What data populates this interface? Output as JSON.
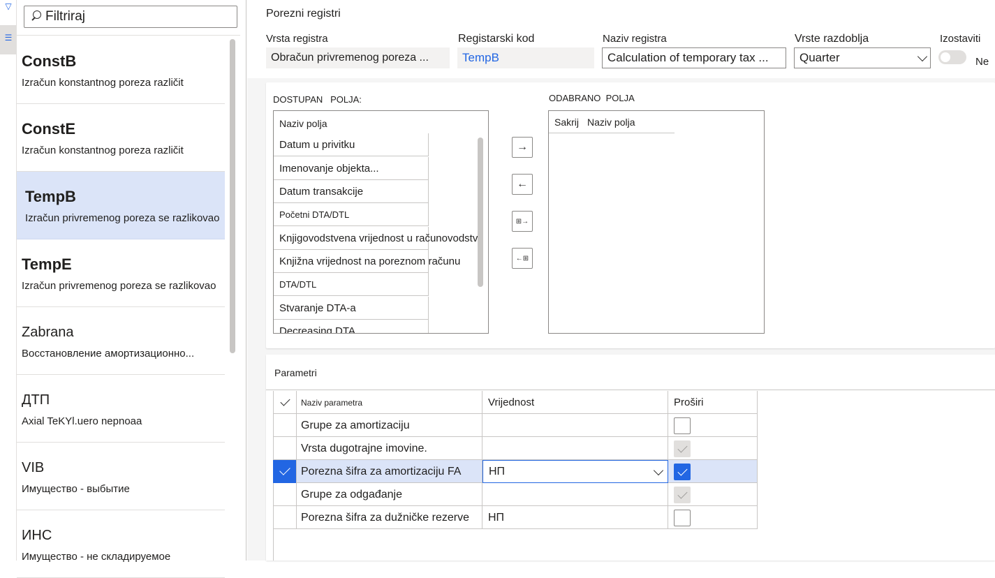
{
  "nav": {
    "icons": [
      "filter-icon",
      "list-icon"
    ]
  },
  "list": {
    "filter_placeholder": "Filtriraj",
    "items": [
      {
        "code": "ConstB",
        "desc": "Izračun konstantnog poreza različit"
      },
      {
        "code": "ConstE",
        "desc": "Izračun konstantnog poreza različit"
      },
      {
        "code": "TempB",
        "desc": "Izračun privremenog poreza se razlikovao"
      },
      {
        "code": "TempE",
        "desc": "Izračun privremenog poreza se razlikovao"
      },
      {
        "code": "Zabrana",
        "desc": "Восстановление амортизационно..."
      },
      {
        "code": "ДТП",
        "desc": "Axial TeKYl.uero nepnoaa"
      },
      {
        "code": "VIB",
        "desc": "Имущество - выбытие"
      },
      {
        "code": "ИНС",
        "desc": "Имущество - не складируемое"
      }
    ]
  },
  "header": {
    "title": "Porezni registri",
    "vrsta_registra_label": "Vrsta registra",
    "vrsta_registra_value": "Obračun privremenog poreza ...",
    "registarski_kod_label": "Registarski kod",
    "registarski_kod_value": "TempB",
    "naziv_registra_label": "Naziv registra",
    "naziv_registra_value": "Calculation of temporary tax ...",
    "vrste_razdoblja_label": "Vrste razdoblja",
    "vrste_razdoblja_value": "Quarter",
    "izostaviti_label": "Izostaviti",
    "izostaviti_value": "Ne"
  },
  "fields": {
    "available_label_1": "DOSTUPAN",
    "available_label_2": "POLJA:",
    "selected_label_1": "ODABRANO",
    "selected_label_2": "POLJA",
    "available_header": "Naziv polja",
    "available_rows": [
      "Datum u privitku",
      "Imenovanje objekta...",
      "Datum transakcije",
      "Početni DTA/DTL",
      "Knjigovodstvena vrijednost u računovodstvu",
      "Knjižna vrijednost na poreznom računu",
      "DTA/DTL",
      "Stvaranje DTA-a",
      "Decreasing DTA"
    ],
    "selected_header_hide": "Sakrij",
    "selected_header_name": "Naziv polja",
    "buttons": [
      "→",
      "←",
      "⊞→",
      "←⊞"
    ]
  },
  "params": {
    "title": "Parametri",
    "col_name": "Naziv parametra",
    "col_value": "Vrijednost",
    "col_expand": "Proširi",
    "rows": [
      {
        "name": "Grupe za amortizaciju",
        "value": "",
        "expand": "unchecked"
      },
      {
        "name": "Vrsta dugotrajne imovine.",
        "value": "",
        "expand": "disabled-checked"
      },
      {
        "name": "Porezna šifra za amortizaciju FA",
        "value": "НП",
        "expand": "checked"
      },
      {
        "name": "Grupe za odgađanje",
        "value": "",
        "expand": "disabled-checked"
      },
      {
        "name": "Porezna šifra za dužničke rezerve",
        "value": "НП",
        "expand": "unchecked"
      }
    ]
  },
  "colors": {
    "accent": "#2266e3",
    "selected_row": "#dbe4f8"
  }
}
